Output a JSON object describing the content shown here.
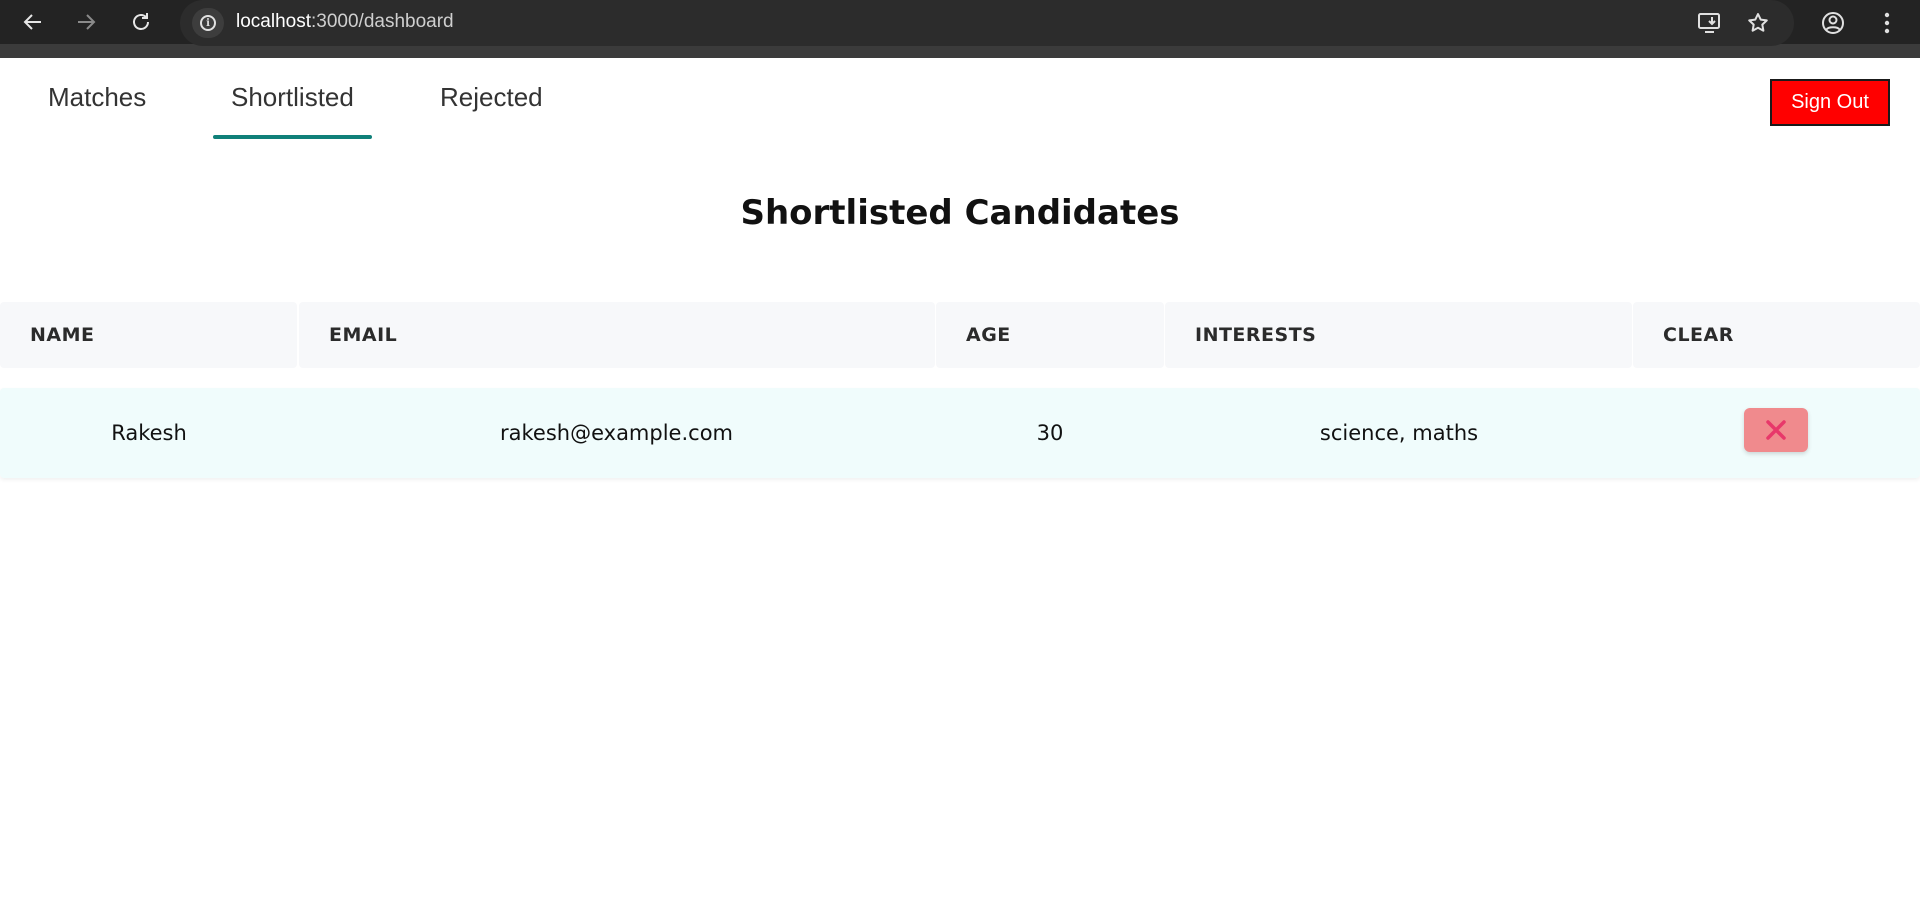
{
  "browser": {
    "url_host": "localhost",
    "url_path": ":3000/dashboard",
    "icons": [
      "back-arrow-icon",
      "forward-arrow-icon",
      "reload-icon",
      "site-info-icon",
      "install-app-icon",
      "bookmark-star-icon",
      "profile-icon",
      "menu-dots-icon"
    ]
  },
  "tabs": [
    {
      "label": "Matches",
      "active": false
    },
    {
      "label": "Shortlisted",
      "active": true
    },
    {
      "label": "Rejected",
      "active": false
    }
  ],
  "signout_label": "Sign Out",
  "page_title": "Shortlisted Candidates",
  "table": {
    "headers": [
      "NAME",
      "EMAIL",
      "AGE",
      "INTERESTS",
      "CLEAR"
    ],
    "rows": [
      {
        "name": "Rakesh",
        "email": "rakesh@example.com",
        "age": "30",
        "interests": "science, maths"
      }
    ]
  },
  "colors": {
    "tab_underline": "#0f8079",
    "signout_bg": "#ff0000",
    "row_bg": "#f0fcfc",
    "clear_button_bg": "#f08a8d",
    "clear_icon": "#e8386a"
  }
}
